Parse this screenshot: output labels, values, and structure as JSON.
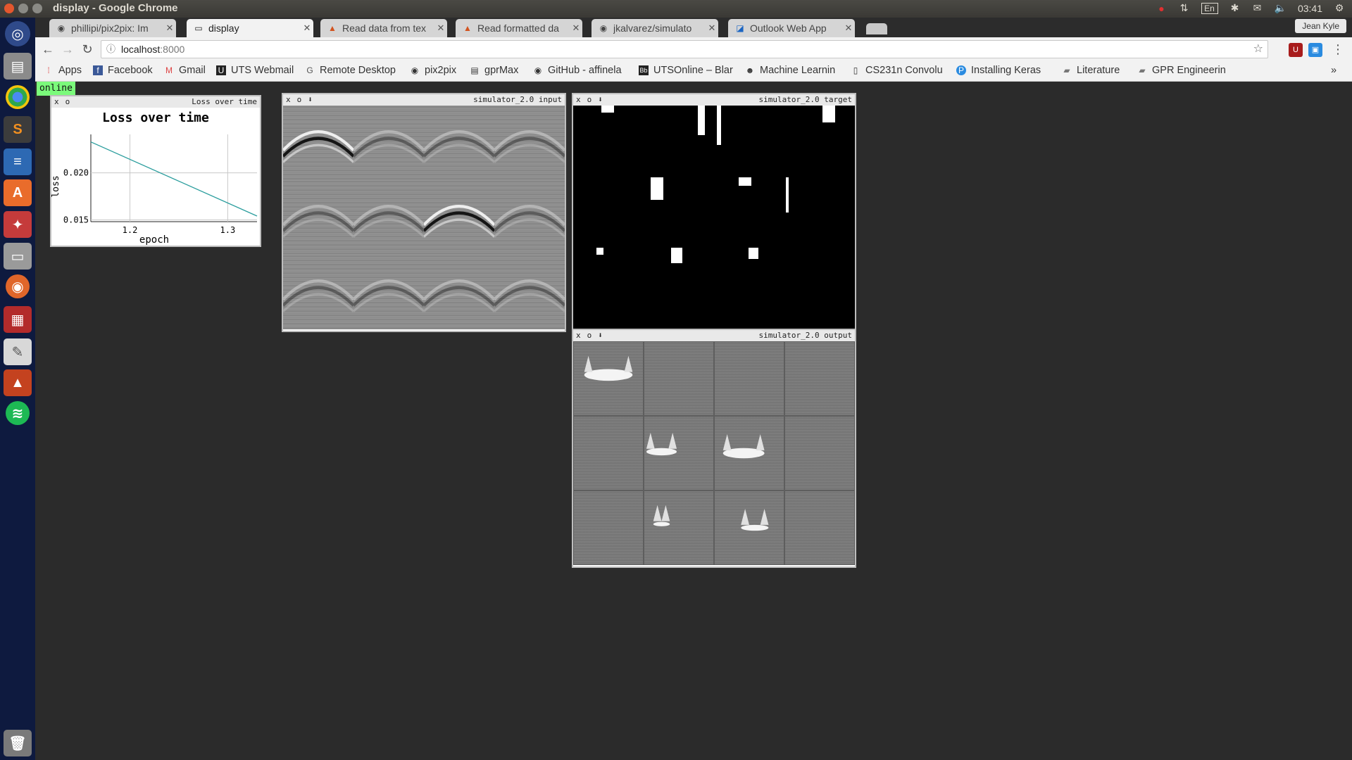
{
  "window": {
    "title": "display - Google Chrome"
  },
  "indicators": {
    "keyboard": "En",
    "time": "03:41"
  },
  "chrome": {
    "user": "Jean Kyle",
    "tabs": [
      {
        "title": "phillipi/pix2pix: Im",
        "icon": "github-icon",
        "active": false
      },
      {
        "title": "display",
        "icon": "page-icon",
        "active": true
      },
      {
        "title": "Read data from tex",
        "icon": "matlab-icon",
        "active": false
      },
      {
        "title": "Read formatted da",
        "icon": "matlab-icon",
        "active": false
      },
      {
        "title": "jkalvarez/simulato",
        "icon": "github-icon",
        "active": false
      },
      {
        "title": "Outlook Web App",
        "icon": "outlook-icon",
        "active": false
      }
    ],
    "url_host": "localhost",
    "url_port": ":8000",
    "bookmarks": [
      {
        "label": "Apps",
        "icon": "apps-grid-icon"
      },
      {
        "label": "Facebook",
        "icon": "facebook-icon"
      },
      {
        "label": "Gmail",
        "icon": "gmail-icon"
      },
      {
        "label": "UTS Webmail",
        "icon": "uts-icon"
      },
      {
        "label": "Remote Desktop",
        "icon": "google-icon"
      },
      {
        "label": "pix2pix",
        "icon": "github-icon"
      },
      {
        "label": "gprMax",
        "icon": "doc-icon"
      },
      {
        "label": "GitHub - affinela",
        "icon": "github-icon"
      },
      {
        "label": "UTSOnline – Blar",
        "icon": "blackboard-icon"
      },
      {
        "label": "Machine Learnin",
        "icon": "reddit-icon"
      },
      {
        "label": "CS231n Convolu",
        "icon": "page-icon"
      },
      {
        "label": "Installing Keras",
        "icon": "p-icon"
      },
      {
        "label": "Literature",
        "icon": "folder-icon"
      },
      {
        "label": "GPR Engineerin",
        "icon": "folder-icon"
      }
    ],
    "overflow": "»"
  },
  "page": {
    "status": "online",
    "panel_controls": [
      "x",
      "o",
      "⬇"
    ],
    "loss_panel": {
      "title": "Loss over time"
    },
    "input_panel": {
      "title": "simulator_2.0 input"
    },
    "target_panel": {
      "title": "simulator_2.0 target"
    },
    "output_panel": {
      "title": "simulator_2.0 output"
    }
  },
  "chart_data": {
    "type": "line",
    "title": "Loss over time",
    "xlabel": "epoch",
    "ylabel": "loss",
    "x": [
      1.16,
      1.33
    ],
    "series": [
      {
        "values": [
          0.0233,
          0.0154
        ],
        "color": "#2a9d9d"
      }
    ],
    "xlim": [
      1.16,
      1.33
    ],
    "ylim": [
      0.0148,
      0.0241
    ],
    "xticks": [
      1.2,
      1.3
    ],
    "xtick_labels": [
      "1.2",
      "1.3"
    ],
    "yticks": [
      0.015,
      0.02
    ],
    "ytick_labels": [
      "0.015",
      "0.020"
    ],
    "grid": true
  }
}
